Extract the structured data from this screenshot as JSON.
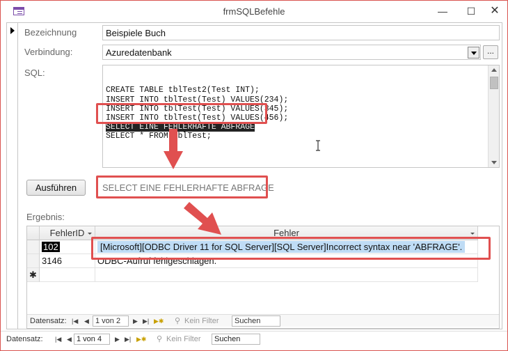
{
  "window": {
    "title": "frmSQLBefehle",
    "minimize": "—",
    "maximize": "☐",
    "close": "✕"
  },
  "form": {
    "bezeichnung_label": "Bezeichnung",
    "bezeichnung_value": "Beispiele Buch",
    "verbindung_label": "Verbindung:",
    "verbindung_value": "Azuredatenbank",
    "dots_label": "...",
    "sql_label": "SQL:",
    "sql_lines": [
      "CREATE TABLE tblTest2(Test INT);",
      "INSERT INTO tblTest(Test) VALUES(234);",
      "INSERT INTO tblTest(Test) VALUES(345);",
      "INSERT INTO tblTest(Test) VALUES(456);",
      "SELECT EINE FEHLERHAFTE ABFRAGE",
      "SELECT * FROM tblTest;"
    ],
    "run_button": "Ausführen",
    "current_statement": "SELECT EINE FEHLERHAFTE ABFRAGE",
    "ergebnis_label": "Ergebnis:"
  },
  "grid": {
    "columns": [
      "FehlerID",
      "Fehler"
    ],
    "rows": [
      {
        "id": "102",
        "fehler": "[Microsoft][ODBC Driver 11 for SQL Server][SQL Server]Incorrect syntax near 'ABFRAGE'."
      },
      {
        "id": "3146",
        "fehler": "ODBC-Aufruf fehlgeschlagen."
      }
    ],
    "new_row_marker": "✱"
  },
  "subform_nav": {
    "label": "Datensatz:",
    "record": "1 von 2",
    "filter": "Kein Filter",
    "search": "Suchen"
  },
  "form_nav": {
    "label": "Datensatz:",
    "record": "1 von 4",
    "filter": "Kein Filter",
    "search": "Suchen"
  },
  "colors": {
    "highlight": "#e05050",
    "selection": "#bfdcf5",
    "dark_selection": "#222222"
  }
}
